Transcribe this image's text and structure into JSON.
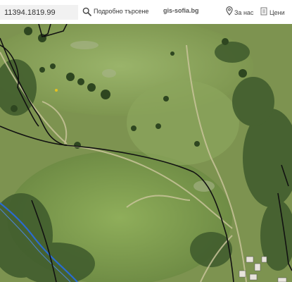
{
  "header": {
    "coordinates_value": "11394.1819.99",
    "advanced_search_label": "Подробно търсене",
    "brand": "gis-sofia.bg",
    "about_label": "За нас",
    "prices_label": "Цени"
  },
  "icons": {
    "search": "search-icon",
    "about": "map-pin-icon",
    "prices": "document-icon"
  },
  "colors": {
    "boundary_line": "#111111",
    "river": "#2a6bd1",
    "vegetation_dark": "#3d5a2a",
    "meadow": "#86a05a"
  }
}
